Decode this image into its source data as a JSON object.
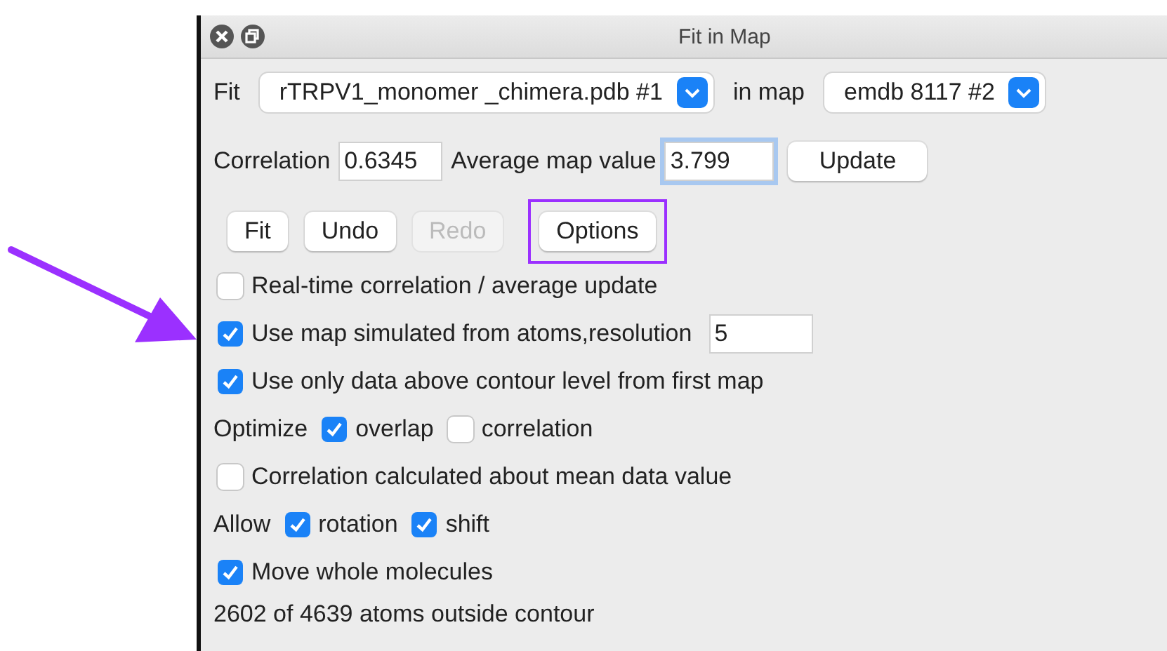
{
  "window": {
    "title": "Fit in Map"
  },
  "fit_row": {
    "fit_label": "Fit",
    "model_menu": "rTRPV1_monomer _chimera.pdb #1",
    "map_label": "in map",
    "map_menu": "emdb 8117 #2"
  },
  "values_row": {
    "correlation_label": "Correlation",
    "correlation": "0.6345",
    "average_label": "Average map value",
    "average": "3.799",
    "average_focused": true,
    "update_button": "Update"
  },
  "buttons": [
    {
      "label": "Fit",
      "disabled": false,
      "highlighted": false
    },
    {
      "label": "Undo",
      "disabled": false,
      "highlighted": false
    },
    {
      "label": "Redo",
      "disabled": true,
      "highlighted": false
    },
    {
      "label": "Options",
      "disabled": false,
      "highlighted": true
    }
  ],
  "options": [
    {
      "kind": "checkbox",
      "label": "Real-time correlation / average update",
      "checked": false,
      "pointed_at": false
    },
    {
      "kind": "checkbox",
      "label": "Use map simulated from atoms,resolution",
      "checked": true,
      "value": "5",
      "pointed_at": true
    },
    {
      "kind": "checkbox",
      "label": "Use only data above contour level from first map",
      "checked": true,
      "pointed_at": false
    },
    {
      "kind": "group",
      "label": "Optimize",
      "items": [
        {
          "label": "overlap",
          "checked": true
        },
        {
          "label": "correlation",
          "checked": false
        }
      ]
    },
    {
      "kind": "checkbox",
      "label": "Correlation calculated about mean data value",
      "checked": false,
      "pointed_at": false
    },
    {
      "kind": "group",
      "label": "Allow",
      "items": [
        {
          "label": "rotation",
          "checked": true
        },
        {
          "label": "shift",
          "checked": true
        }
      ]
    },
    {
      "kind": "checkbox",
      "label": "Move whole molecules",
      "checked": true,
      "pointed_at": false
    },
    {
      "kind": "text",
      "label": "2602 of 4639 atoms outside contour"
    }
  ]
}
